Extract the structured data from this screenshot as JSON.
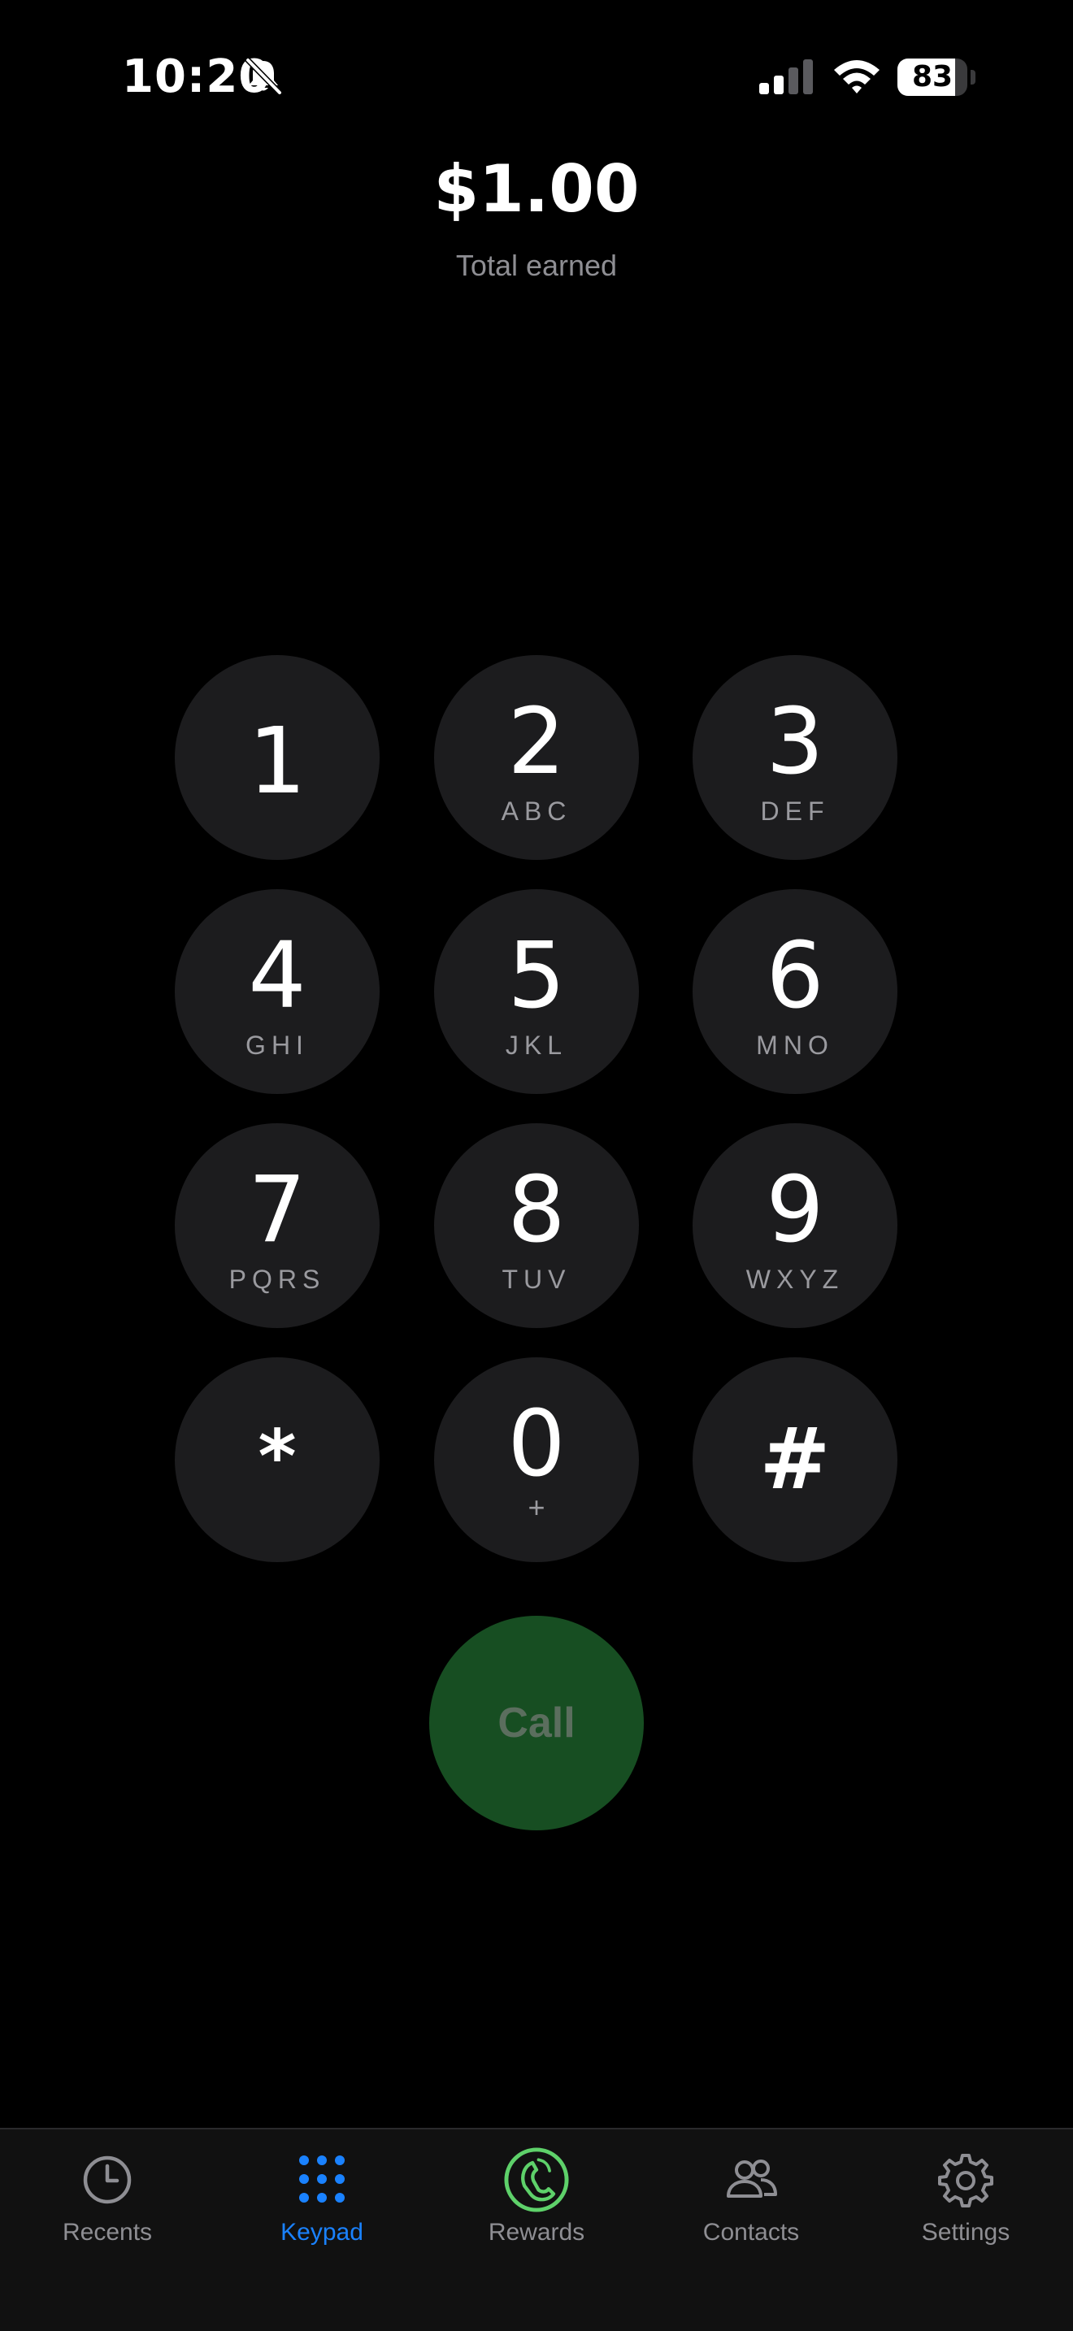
{
  "status_bar": {
    "time": "10:20",
    "battery_percent": 83,
    "battery_label": "83"
  },
  "earnings": {
    "amount": "$1.00",
    "label": "Total earned"
  },
  "keypad": {
    "keys": [
      {
        "digit": "1",
        "letters": ""
      },
      {
        "digit": "2",
        "letters": "ABC"
      },
      {
        "digit": "3",
        "letters": "DEF"
      },
      {
        "digit": "4",
        "letters": "GHI"
      },
      {
        "digit": "5",
        "letters": "JKL"
      },
      {
        "digit": "6",
        "letters": "MNO"
      },
      {
        "digit": "7",
        "letters": "PQRS"
      },
      {
        "digit": "8",
        "letters": "TUV"
      },
      {
        "digit": "9",
        "letters": "WXYZ"
      },
      {
        "digit": "*",
        "letters": ""
      },
      {
        "digit": "0",
        "letters": "+"
      },
      {
        "digit": "#",
        "letters": ""
      }
    ],
    "call_label": "Call"
  },
  "tab_bar": {
    "tabs": [
      {
        "label": "Recents",
        "icon": "clock-icon"
      },
      {
        "label": "Keypad",
        "icon": "keypad-grid-icon"
      },
      {
        "label": "Rewards",
        "icon": "phone-rewards-icon"
      },
      {
        "label": "Contacts",
        "icon": "people-icon"
      },
      {
        "label": "Settings",
        "icon": "gear-icon"
      }
    ],
    "active": "Keypad"
  },
  "colors": {
    "accent_blue": "#1a82ff",
    "call_green": "#174e22",
    "rewards_green": "#5ed16a",
    "key_background": "#1c1c1e"
  }
}
